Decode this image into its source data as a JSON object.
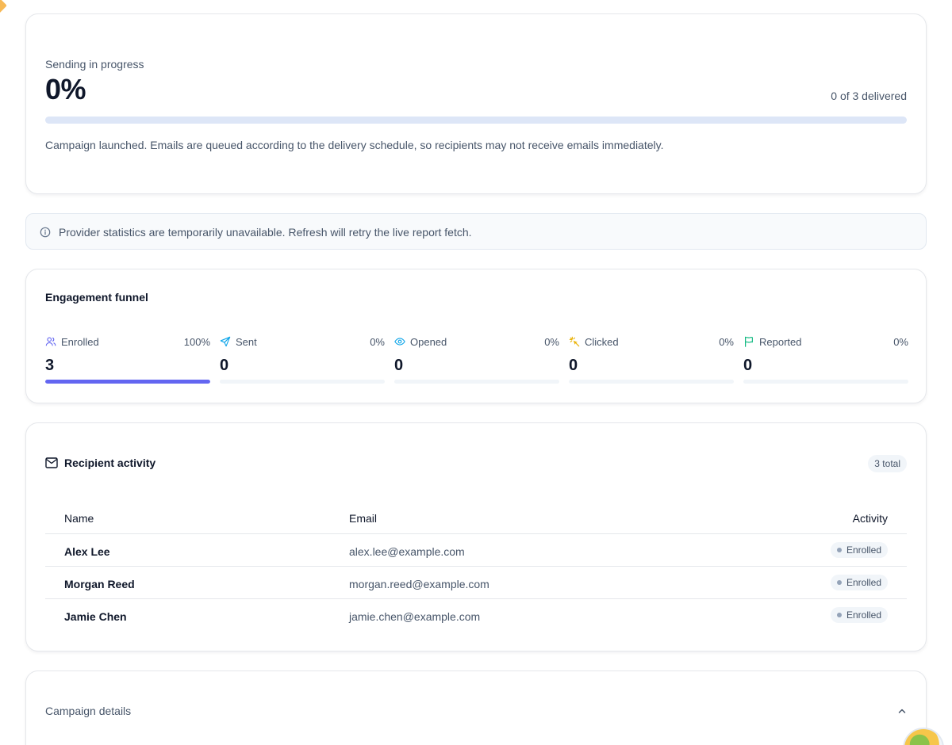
{
  "progress": {
    "label": "Sending in progress",
    "percent_text": "0%",
    "percent_value": 0,
    "delivered_text": "0 of 3 delivered",
    "note": "Campaign launched. Emails are queued according to the delivery schedule, so recipients may not receive emails immediately."
  },
  "alert": {
    "icon": "info-icon",
    "text": "Provider statistics are temporarily unavailable. Refresh will retry the live report fetch."
  },
  "funnel": {
    "title": "Engagement funnel",
    "stages": [
      {
        "label": "Enrolled",
        "icon": "users-icon",
        "percent_text": "100%",
        "percent_value": 100,
        "count": "3"
      },
      {
        "label": "Sent",
        "icon": "send-icon",
        "percent_text": "0%",
        "percent_value": 0,
        "count": "0"
      },
      {
        "label": "Opened",
        "icon": "eye-icon",
        "percent_text": "0%",
        "percent_value": 0,
        "count": "0"
      },
      {
        "label": "Clicked",
        "icon": "sparkle-click-icon",
        "percent_text": "0%",
        "percent_value": 0,
        "count": "0"
      },
      {
        "label": "Reported",
        "icon": "flag-icon",
        "percent_text": "0%",
        "percent_value": 0,
        "count": "0"
      }
    ]
  },
  "recipients": {
    "title": "Recipient activity",
    "icon": "mail-icon",
    "total_badge": "3 total",
    "columns": {
      "name": "Name",
      "email": "Email",
      "activity": "Activity"
    },
    "rows": [
      {
        "name": "Alex Lee",
        "email": "alex.lee@example.com",
        "activity": "Enrolled"
      },
      {
        "name": "Morgan Reed",
        "email": "morgan.reed@example.com",
        "activity": "Enrolled"
      },
      {
        "name": "Jamie Chen",
        "email": "jamie.chen@example.com",
        "activity": "Enrolled"
      }
    ]
  },
  "details": {
    "title": "Campaign details",
    "icon": "chevron-up-icon"
  },
  "colors": {
    "accent": "#6366f1",
    "track": "#dde6f7",
    "muted_text": "#475569",
    "border": "#e5e7eb"
  }
}
